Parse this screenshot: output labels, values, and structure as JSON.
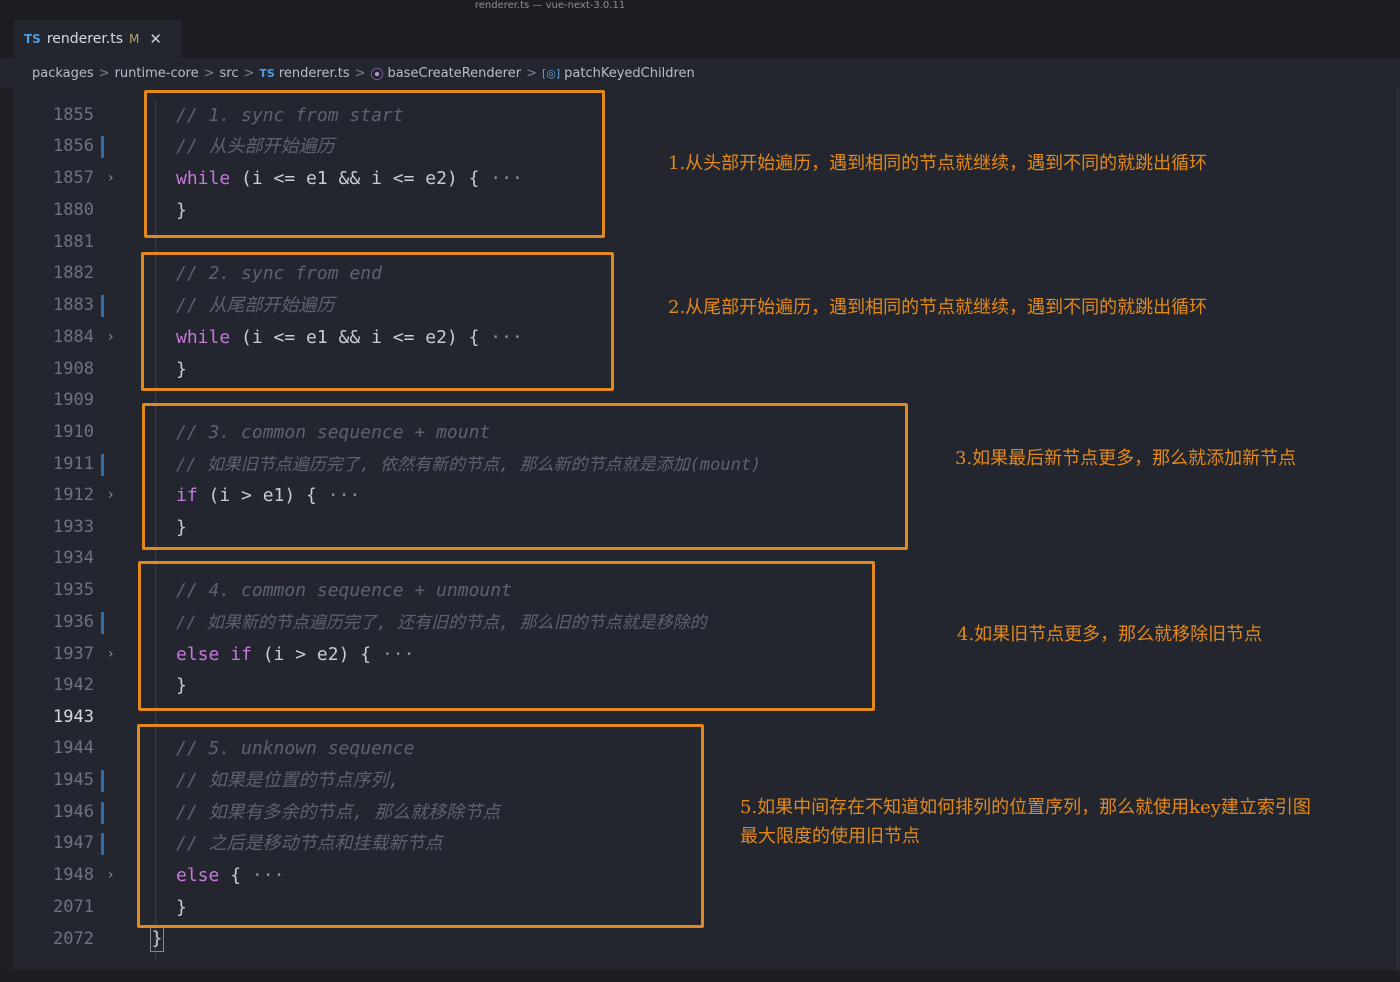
{
  "window": {
    "title": "renderer.ts — vue-next-3.0.11"
  },
  "tab": {
    "lang_badge": "TS",
    "filename": "renderer.ts",
    "modified_marker": "M",
    "close_glyph": "✕"
  },
  "breadcrumb": {
    "items": [
      "packages",
      "runtime-core",
      "src",
      "renderer.ts",
      "baseCreateRenderer",
      "patchKeyedChildren"
    ],
    "ts_badge": "TS",
    "function_icon_glyph": "⦿",
    "variable_icon_glyph": "[◎]",
    "separator": ">"
  },
  "lines": [
    {
      "num": "1855",
      "fold": false,
      "modified": false
    },
    {
      "num": "1856",
      "fold": false,
      "modified": true
    },
    {
      "num": "1857",
      "fold": true,
      "modified": false
    },
    {
      "num": "1880",
      "fold": false,
      "modified": false
    },
    {
      "num": "1881",
      "fold": false,
      "modified": false
    },
    {
      "num": "1882",
      "fold": false,
      "modified": false
    },
    {
      "num": "1883",
      "fold": false,
      "modified": true
    },
    {
      "num": "1884",
      "fold": true,
      "modified": false
    },
    {
      "num": "1908",
      "fold": false,
      "modified": false
    },
    {
      "num": "1909",
      "fold": false,
      "modified": false
    },
    {
      "num": "1910",
      "fold": false,
      "modified": false
    },
    {
      "num": "1911",
      "fold": false,
      "modified": true
    },
    {
      "num": "1912",
      "fold": true,
      "modified": false
    },
    {
      "num": "1933",
      "fold": false,
      "modified": false
    },
    {
      "num": "1934",
      "fold": false,
      "modified": false
    },
    {
      "num": "1935",
      "fold": false,
      "modified": false
    },
    {
      "num": "1936",
      "fold": false,
      "modified": true
    },
    {
      "num": "1937",
      "fold": true,
      "modified": false
    },
    {
      "num": "1942",
      "fold": false,
      "modified": false
    },
    {
      "num": "1943",
      "fold": false,
      "modified": false,
      "active": true
    },
    {
      "num": "1944",
      "fold": false,
      "modified": false
    },
    {
      "num": "1945",
      "fold": false,
      "modified": true
    },
    {
      "num": "1946",
      "fold": false,
      "modified": true
    },
    {
      "num": "1947",
      "fold": false,
      "modified": true
    },
    {
      "num": "1948",
      "fold": true,
      "modified": false
    },
    {
      "num": "2071",
      "fold": false,
      "modified": false
    },
    {
      "num": "2072",
      "fold": false,
      "modified": false
    }
  ],
  "code": {
    "l1855": "// 1. sync from start",
    "l1856": "// 从头部开始遍历",
    "l1857_kw": "while",
    "l1857_rest": " (i <= e1 && i <= e2) {",
    "l1880": "}",
    "l1882": "// 2. sync from end",
    "l1883": "// 从尾部开始遍历",
    "l1884_kw": "while",
    "l1884_rest": " (i <= e1 && i <= e2) {",
    "l1908": "}",
    "l1910": "// 3. common sequence + mount",
    "l1911": "// 如果旧节点遍历完了, 依然有新的节点, 那么新的节点就是添加(mount)",
    "l1912_kw": "if",
    "l1912_rest": " (i > e1) {",
    "l1933": "}",
    "l1935": "// 4. common sequence + unmount",
    "l1936": "// 如果新的节点遍历完了, 还有旧的节点, 那么旧的节点就是移除的",
    "l1937_kw1": "else",
    "l1937_kw2": " if",
    "l1937_rest": " (i > e2) {",
    "l1942": "}",
    "l1944": "// 5. unknown sequence",
    "l1945": "// 如果是位置的节点序列,",
    "l1946": "// 如果有多余的节点, 那么就移除节点",
    "l1947": "// 之后是移动节点和挂载新节点",
    "l1948_kw": "else",
    "l1948_rest": " {",
    "l2071": "}",
    "ellipsis": "···",
    "close_brace": "}"
  },
  "annotations": {
    "note1": "1.从头部开始遍历，遇到相同的节点就继续，遇到不同的就跳出循环",
    "note2": "2.从尾部开始遍历，遇到相同的节点就继续，遇到不同的就跳出循环",
    "note3": "3.如果最后新节点更多，那么就添加新节点",
    "note4": "4.如果旧节点更多，那么就移除旧节点",
    "note5_line1": "5.如果中间存在不知道如何排列的位置序列，那么就使用key建立索引图",
    "note5_line2": "最大限度的使用旧节点"
  },
  "colors": {
    "annotation": "#e3891c",
    "keyword": "#c678dd",
    "comment": "#5c6370",
    "background": "#23262e"
  }
}
